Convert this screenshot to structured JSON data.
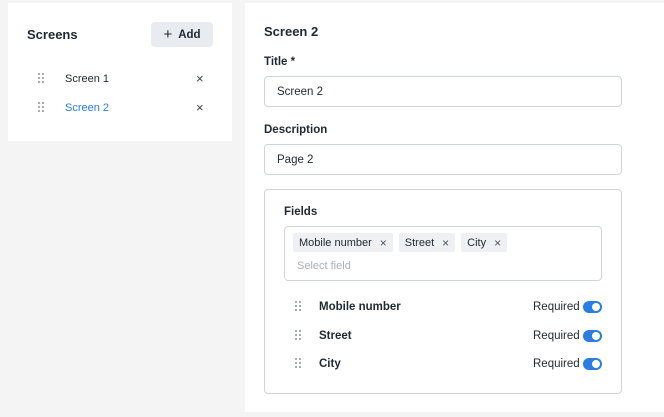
{
  "sidebar": {
    "title": "Screens",
    "add_label": "Add",
    "add_icon": "plus-icon",
    "items": [
      {
        "label": "Screen 1",
        "active": false
      },
      {
        "label": "Screen 2",
        "active": true
      }
    ],
    "remove_glyph": "×"
  },
  "editor": {
    "heading": "Screen 2",
    "title_label": "Title *",
    "title_value": "Screen 2",
    "description_label": "Description",
    "description_value": "Page 2",
    "fields_label": "Fields",
    "select_placeholder": "Select field",
    "chips": [
      "Mobile number",
      "Street",
      "City"
    ],
    "rows": [
      {
        "label": "Mobile number",
        "required_label": "Required",
        "required": true
      },
      {
        "label": "Street",
        "required_label": "Required",
        "required": true
      },
      {
        "label": "City",
        "required_label": "Required",
        "required": true
      }
    ]
  },
  "colors": {
    "accent": "#2a7de1",
    "background": "#f4f4f5",
    "panel": "#ffffff"
  }
}
